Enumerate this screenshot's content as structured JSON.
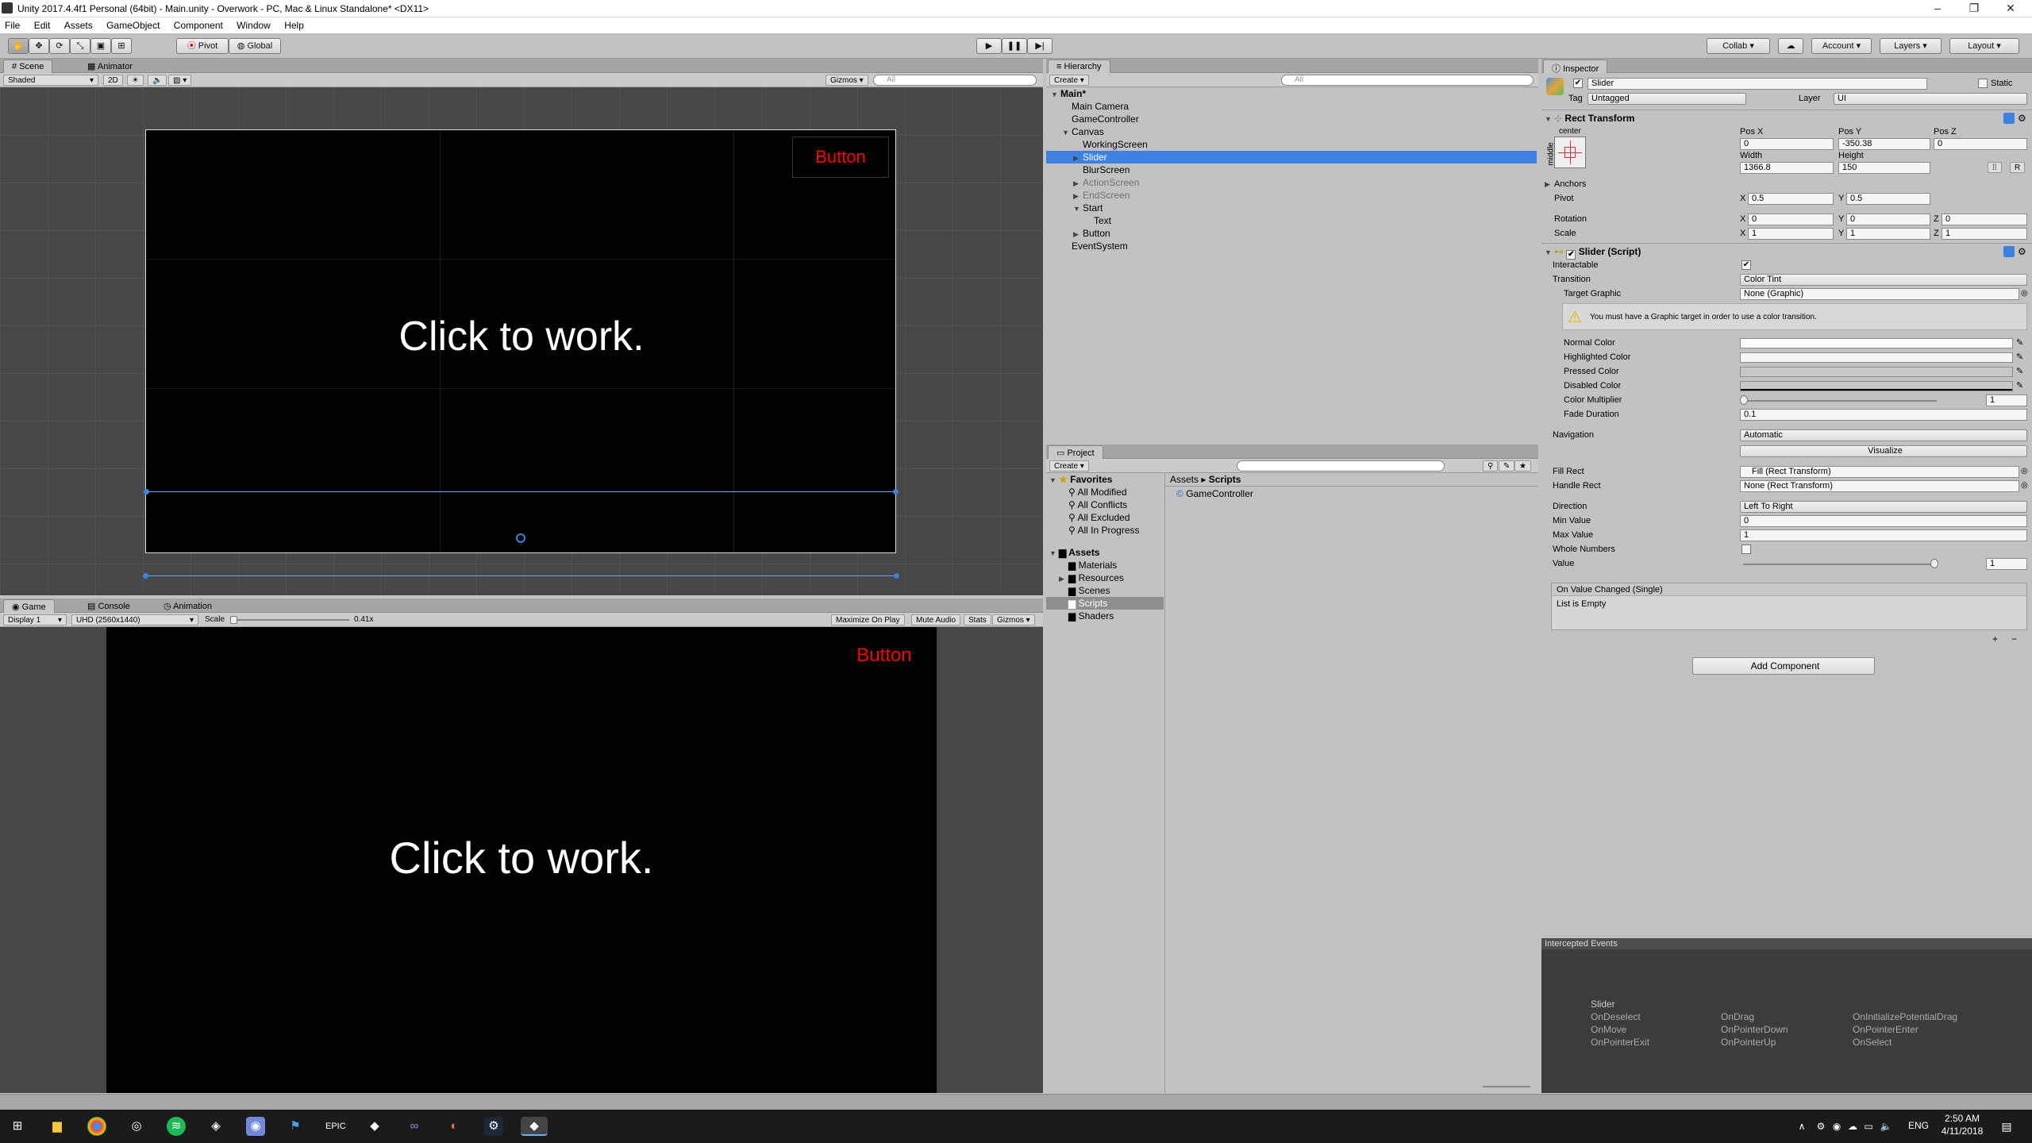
{
  "window": {
    "title": "Unity 2017.4.4f1 Personal (64bit) - Main.unity - Overwork - PC, Mac & Linux Standalone* <DX11>",
    "minimize": "–",
    "restore": "❐",
    "close": "✕"
  },
  "menu": [
    "File",
    "Edit",
    "Assets",
    "GameObject",
    "Component",
    "Window",
    "Help"
  ],
  "toolbar": {
    "pivot": "Pivot",
    "global": "Global",
    "play": "▶",
    "pause": "❚❚",
    "step": "▶|",
    "collab": "Collab ▾",
    "cloud": "☁",
    "account": "Account",
    "layers": "Layers",
    "layout": "Layout"
  },
  "scene": {
    "tabs": [
      "Scene",
      "Animator"
    ],
    "shading": "Shaded",
    "mode2d": "2D",
    "gizmos": "Gizmos",
    "search_placeholder": "All",
    "button_label": "Button",
    "center_text": "Click to work."
  },
  "game": {
    "tabs": [
      "Game",
      "Console",
      "Animation"
    ],
    "display": "Display 1",
    "resolution": "UHD (2560x1440)",
    "scale_label": "Scale",
    "scale_value": "0.41x",
    "maximize": "Maximize On Play",
    "mute": "Mute Audio",
    "stats": "Stats",
    "gizmos": "Gizmos",
    "button_label": "Button",
    "center_text": "Click to work."
  },
  "hierarchy": {
    "tab": "Hierarchy",
    "create": "Create",
    "search_placeholder": "All",
    "items": [
      {
        "label": "Main*",
        "indent": 0,
        "arrow": "▼",
        "style": "bold"
      },
      {
        "label": "Main Camera",
        "indent": 1,
        "arrow": "",
        "style": ""
      },
      {
        "label": "GameController",
        "indent": 1,
        "arrow": "",
        "style": ""
      },
      {
        "label": "Canvas",
        "indent": 1,
        "arrow": "▼",
        "style": ""
      },
      {
        "label": "WorkingScreen",
        "indent": 2,
        "arrow": "",
        "style": ""
      },
      {
        "label": "Slider",
        "indent": 2,
        "arrow": "▶",
        "style": "sel"
      },
      {
        "label": "BlurScreen",
        "indent": 2,
        "arrow": "",
        "style": ""
      },
      {
        "label": "ActionScreen",
        "indent": 2,
        "arrow": "▶",
        "style": "grey"
      },
      {
        "label": "EndScreen",
        "indent": 2,
        "arrow": "▶",
        "style": "grey"
      },
      {
        "label": "Start",
        "indent": 2,
        "arrow": "▼",
        "style": ""
      },
      {
        "label": "Text",
        "indent": 3,
        "arrow": "",
        "style": ""
      },
      {
        "label": "Button",
        "indent": 2,
        "arrow": "▶",
        "style": ""
      },
      {
        "label": "EventSystem",
        "indent": 1,
        "arrow": "",
        "style": ""
      }
    ]
  },
  "project": {
    "tab": "Project",
    "create": "Create",
    "favorites_label": "Favorites",
    "favorites": [
      "All Modified",
      "All Conflicts",
      "All Excluded",
      "All In Progress"
    ],
    "assets_label": "Assets",
    "folders": [
      "Materials",
      "Resources",
      "Scenes",
      "Scripts",
      "Shaders"
    ],
    "breadcrumb_root": "Assets",
    "breadcrumb_sep": "▸",
    "breadcrumb_current": "Scripts",
    "files": [
      "GameController"
    ]
  },
  "inspector": {
    "tab": "Inspector",
    "object_name": "Slider",
    "static_label": "Static",
    "tag_label": "Tag",
    "tag_value": "Untagged",
    "layer_label": "Layer",
    "layer_value": "UI",
    "rect": {
      "title": "Rect Transform",
      "anchor_h": "center",
      "anchor_v": "middle",
      "posx_label": "Pos X",
      "posy_label": "Pos Y",
      "posz_label": "Pos Z",
      "posx": "0",
      "posy": "-350.38",
      "posz": "0",
      "width_label": "Width",
      "height_label": "Height",
      "width": "1366.8",
      "height": "150",
      "r_btn": "R",
      "anchors": "Anchors",
      "pivot_label": "Pivot",
      "pivot_x": "0.5",
      "pivot_y": "0.5",
      "rotation_label": "Rotation",
      "rot_x": "0",
      "rot_y": "0",
      "rot_z": "0",
      "scale_label": "Scale",
      "scale_x": "1",
      "scale_y": "1",
      "scale_z": "1",
      "x": "X",
      "y": "Y",
      "z": "Z"
    },
    "slider": {
      "title": "Slider (Script)",
      "interactable": "Interactable",
      "transition": "Transition",
      "transition_value": "Color Tint",
      "target_graphic": "Target Graphic",
      "target_graphic_value": "None (Graphic)",
      "warning": "You must have a Graphic target in order to use a color transition.",
      "normal_color": "Normal Color",
      "highlighted_color": "Highlighted Color",
      "pressed_color": "Pressed Color",
      "disabled_color": "Disabled Color",
      "color_multiplier": "Color Multiplier",
      "color_multiplier_value": "1",
      "fade_duration": "Fade Duration",
      "fade_duration_value": "0.1",
      "navigation": "Navigation",
      "navigation_value": "Automatic",
      "visualize": "Visualize",
      "fill_rect": "Fill Rect",
      "fill_rect_value": "Fill (Rect Transform)",
      "handle_rect": "Handle Rect",
      "handle_rect_value": "None (Rect Transform)",
      "direction": "Direction",
      "direction_value": "Left To Right",
      "min_value": "Min Value",
      "min_value_v": "0",
      "max_value": "Max Value",
      "max_value_v": "1",
      "whole_numbers": "Whole Numbers",
      "value": "Value",
      "value_v": "1",
      "event_title": "On Value Changed (Single)",
      "event_empty": "List is Empty",
      "plus": "+",
      "minus": "−"
    },
    "add_component": "Add Component"
  },
  "events": {
    "title": "Intercepted Events",
    "object": "Slider",
    "list": [
      "OnDeselect",
      "OnDrag",
      "OnInitializePotentialDrag",
      "OnMove",
      "OnPointerDown",
      "OnPointerEnter",
      "OnPointerExit",
      "OnPointerUp",
      "OnSelect"
    ]
  },
  "taskbar": {
    "language": "ENG",
    "time": "2:50 AM",
    "date": "4/11/2018"
  },
  "colors": {
    "selection": "#3d80df",
    "button_text": "#ff0000",
    "panel": "#c2c2c2"
  }
}
